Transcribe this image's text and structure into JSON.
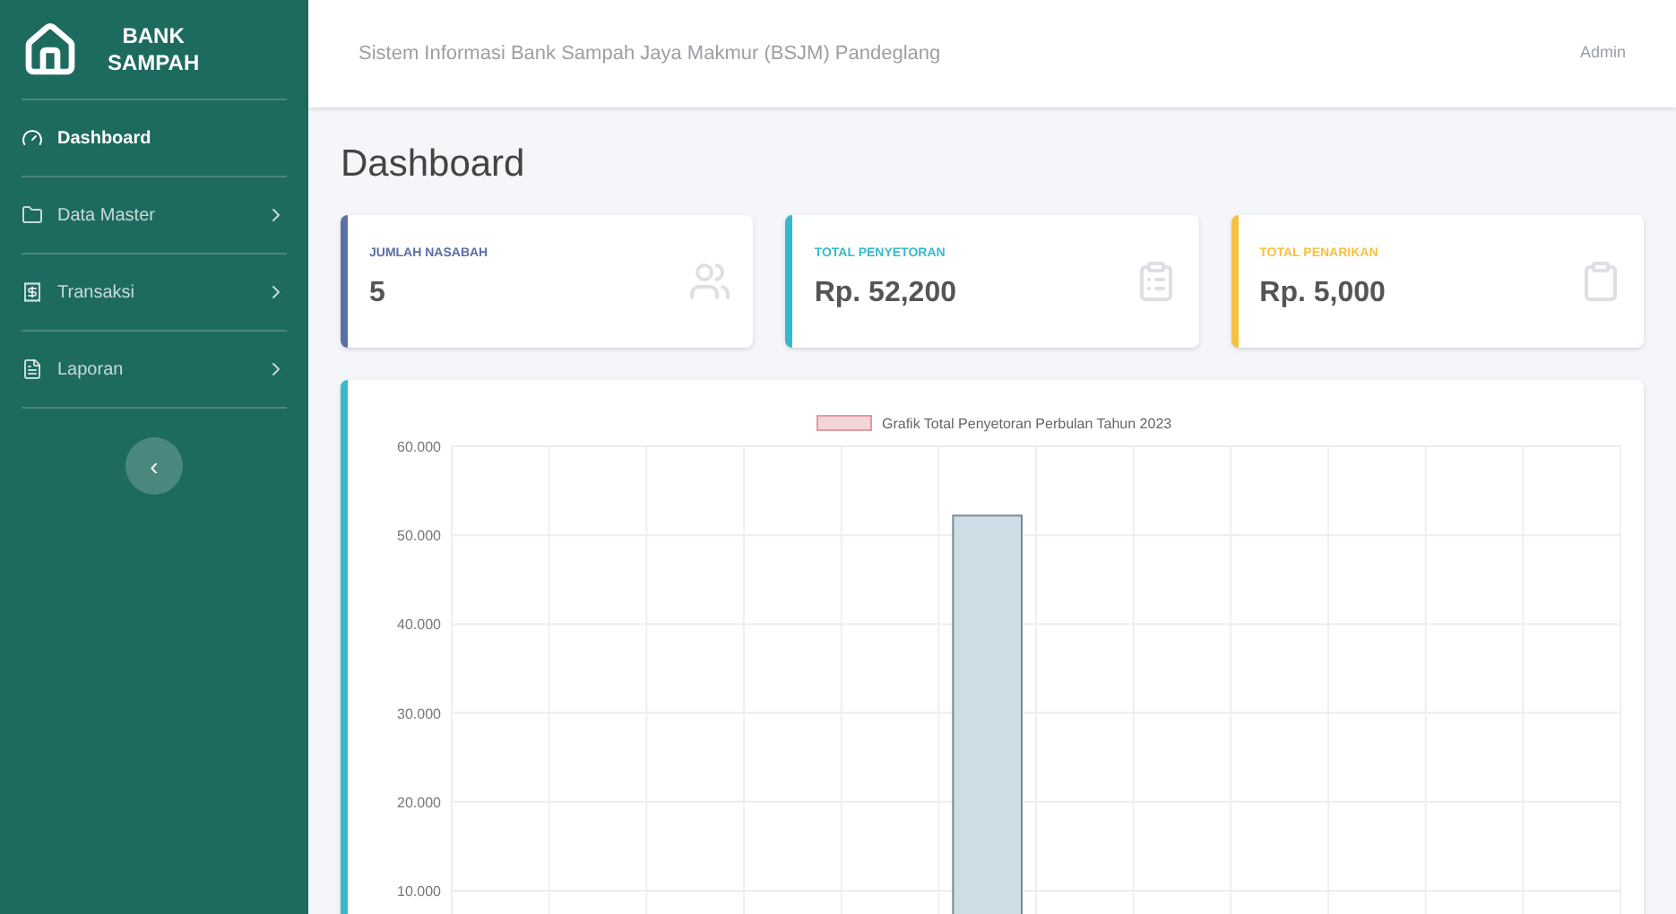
{
  "brand": {
    "line_1": "BANK",
    "line_2": "SAMPAH"
  },
  "sidebar": {
    "items": [
      {
        "label": "Dashboard",
        "selected": true,
        "has_submenu": false
      },
      {
        "label": "Data Master",
        "selected": false,
        "has_submenu": true
      },
      {
        "label": "Transaksi",
        "selected": false,
        "has_submenu": true
      },
      {
        "label": "Laporan",
        "selected": false,
        "has_submenu": true
      }
    ],
    "toggle": "‹"
  },
  "topbar": {
    "title": "Sistem Informasi Bank Sampah Jaya Makmur (BSJM) Pandeglang",
    "user": "Admin"
  },
  "page_title": "Dashboard",
  "cards": [
    {
      "label": "JUMLAH NASABAH",
      "value": "5",
      "color": "#5a6fa8",
      "kind": "users"
    },
    {
      "label": "TOTAL PENYETORAN",
      "value": "Rp. 52,200",
      "color": "#36b9cc",
      "kind": "list"
    },
    {
      "label": "TOTAL PENARIKAN",
      "value": "Rp. 5,000",
      "color": "#f6c23e",
      "kind": "clipboard"
    }
  ],
  "chart_data": {
    "type": "bar",
    "grid": true,
    "series": [
      {
        "name": "Grafik Total Penyetoran Perbulan Tahun 2023",
        "color": "#cfdde6",
        "values": [
          0,
          0,
          0,
          0,
          0,
          52.2,
          0,
          0,
          0,
          0,
          0,
          0
        ]
      }
    ],
    "ylim": [
      0,
      60
    ],
    "yticks": [
      {
        "value": 10,
        "label": "10.000"
      },
      {
        "value": 20,
        "label": "20.000"
      },
      {
        "value": 30,
        "label": "30.000"
      },
      {
        "value": 40,
        "label": "40.000"
      },
      {
        "value": 50,
        "label": "50.000"
      },
      {
        "value": 60,
        "label": "60.000"
      }
    ]
  }
}
